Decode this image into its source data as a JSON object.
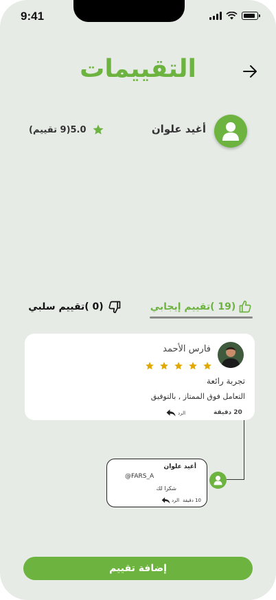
{
  "status_bar": {
    "time": "9:41"
  },
  "header": {
    "title": "التقييمات"
  },
  "profile": {
    "name": "أغيد علوان",
    "rating_summary": "5.0(9 تقييم)"
  },
  "tabs": {
    "positive_label": "(19 )تقييم إيجابي",
    "negative_label": "(0 )تقييم سلبي"
  },
  "review": {
    "reviewer_name": "فارس الأحمد",
    "stars": 5,
    "title": "تجربة رائعة",
    "body": "التعامل فوق الممتاز , بالتوفيق",
    "time": "20 دقيقة",
    "reply_label": "الرد"
  },
  "reply": {
    "author": "أغيد علوان",
    "mention": "@FARS_A",
    "text": "شكرا لك",
    "time": "10 دقيقة",
    "reply_label": "الرد"
  },
  "actions": {
    "add_rating": "إضافة تقييم"
  },
  "colors": {
    "accent": "#6db33f",
    "background": "#e6ebe6",
    "star": "#e0a800"
  }
}
